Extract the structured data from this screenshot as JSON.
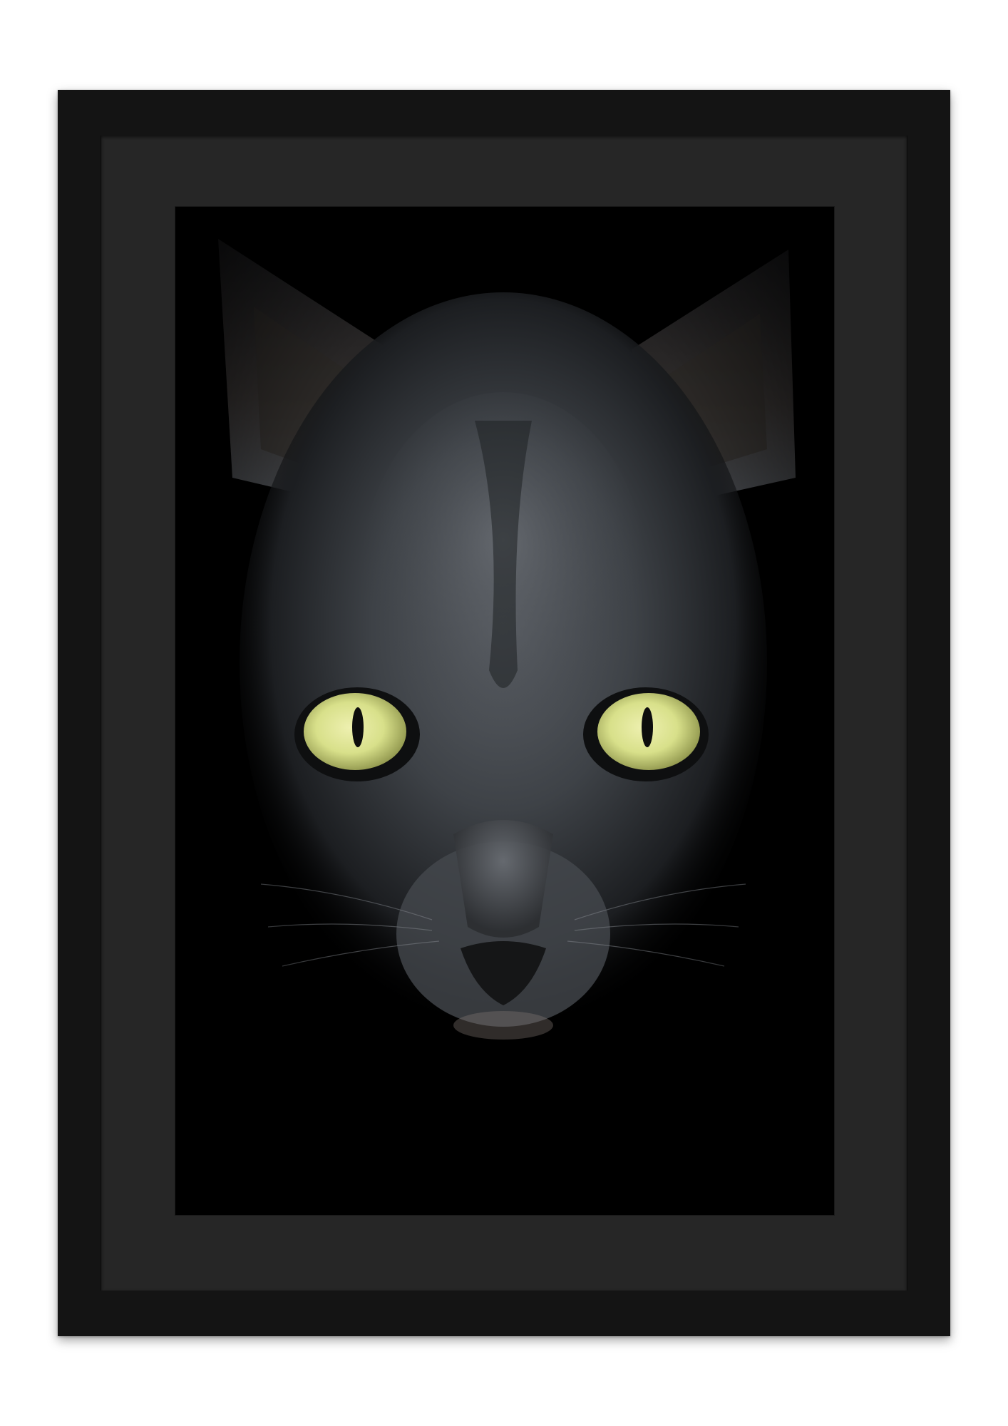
{
  "artwork": {
    "subject": "cat-photo",
    "frame_color": "#141414",
    "mat_color": "#262626",
    "background_color": "#ffffff",
    "photo_background": "#000000",
    "fur_color": "#3e4247",
    "eye_color": "#d8e08a",
    "pupil_color": "#0d0d0d"
  }
}
